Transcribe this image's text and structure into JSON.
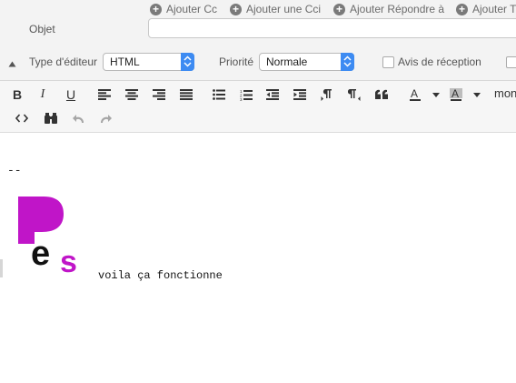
{
  "header": {
    "add_links": [
      {
        "label": "Ajouter Cc"
      },
      {
        "label": "Ajouter une Cci"
      },
      {
        "label": "Ajouter Répondre à"
      },
      {
        "label": "Ajouter T"
      }
    ],
    "subject_label": "Objet",
    "subject_value": "",
    "editor_type_label": "Type d'éditeur",
    "editor_type_value": "HTML",
    "priority_label": "Priorité",
    "priority_value": "Normale",
    "receipt_label": "Avis de réception"
  },
  "toolbar": {
    "font_label": "mon",
    "buttons": [
      "bold",
      "italic",
      "underline",
      "align-left",
      "align-center",
      "align-right",
      "justify",
      "bullet-list",
      "numbered-list",
      "outdent",
      "indent",
      "ltr",
      "rtl",
      "blockquote",
      "text-color",
      "background-color",
      "source-code",
      "find-replace",
      "undo",
      "redo"
    ]
  },
  "editor": {
    "signature_separator": "--",
    "logo_text": "Pes",
    "body_text": "voila ça fonctionne",
    "logo_colors": {
      "p": "#c015c8",
      "e": "#111111",
      "s": "#c015c8"
    }
  }
}
